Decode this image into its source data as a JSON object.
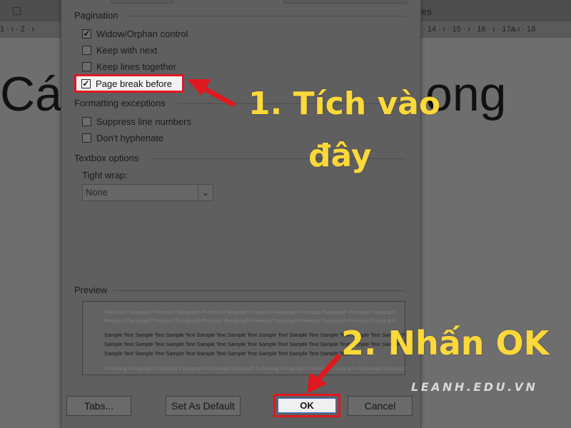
{
  "background": {
    "styles_label": "yles",
    "ruler_left": "1 · ı · 2 · ı",
    "ruler_right": "· 14 · ı · 15 · ı · 16 · ı · 17 · ı · 18",
    "heading_left": "Các",
    "heading_right": "ong"
  },
  "dialog": {
    "pagination": {
      "title": "Pagination",
      "options": [
        {
          "label": "Widow/Orphan control",
          "checked": true
        },
        {
          "label": "Keep with next",
          "checked": false
        },
        {
          "label": "Keep lines together",
          "checked": false
        },
        {
          "label": "Page break before",
          "checked": true
        }
      ]
    },
    "formatting": {
      "title": "Formatting exceptions",
      "options": [
        {
          "label": "Suppress line numbers",
          "checked": false
        },
        {
          "label": "Don't hyphenate",
          "checked": false
        }
      ]
    },
    "textbox": {
      "title": "Textbox options",
      "tight_wrap_label": "Tight wrap:",
      "tight_wrap_value": "None"
    },
    "preview": {
      "title": "Preview",
      "previous": "Previous Paragraph Previous Paragraph Previous Paragraph Previous Paragraph Previous Paragraph Previous Paragraph",
      "sample": "Sample Text Sample Text Sample Text Sample Text Sample Text Sample Text Sample Text Sample Text Sample Text Sample Text Sample Text",
      "sample_last": "Sample Text Sample Text Sample Text Sample Text Sample Text Sample Text Sample Text Sample Text",
      "following": "Following Paragraph Following Paragraph Following Paragraph Following Paragraph Following Paragraph Following Paragraph"
    },
    "buttons": {
      "tabs": "Tabs...",
      "set_default": "Set As Default",
      "ok": "OK",
      "cancel": "Cancel"
    }
  },
  "annotations": {
    "step1_line1": "1. Tích vào",
    "step1_line2": "đây",
    "step2": "2. Nhấn OK",
    "watermark": "LEANH.EDU.VN",
    "text_color": "#ffd83a",
    "highlight_color": "#e0181f"
  }
}
